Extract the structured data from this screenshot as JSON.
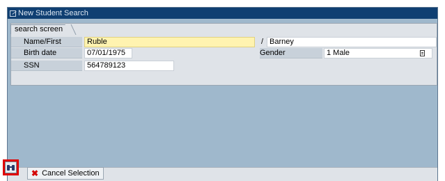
{
  "window": {
    "title": "New Student Search"
  },
  "tab": {
    "label": "search screen"
  },
  "form": {
    "name_label": "Name/First",
    "last_name": "Ruble",
    "name_separator": "/",
    "first_name": "Barney",
    "birth_label": "Birth date",
    "birth_date": "07/01/1975",
    "gender_label": "Gender",
    "gender_value": "1 Male",
    "ssn_label": "SSN",
    "ssn_value": "564789123"
  },
  "footer": {
    "cancel_label": "Cancel Selection"
  },
  "icons": {
    "title": "window-icon",
    "find": "binoculars-icon",
    "cancel": "cancel-x-icon",
    "dropdown": "list-icon"
  },
  "colors": {
    "titlebar": "#0f3f72",
    "workspace": "#9fb8cc",
    "highlight": "#e00000",
    "active_field": "#fff3b0"
  }
}
